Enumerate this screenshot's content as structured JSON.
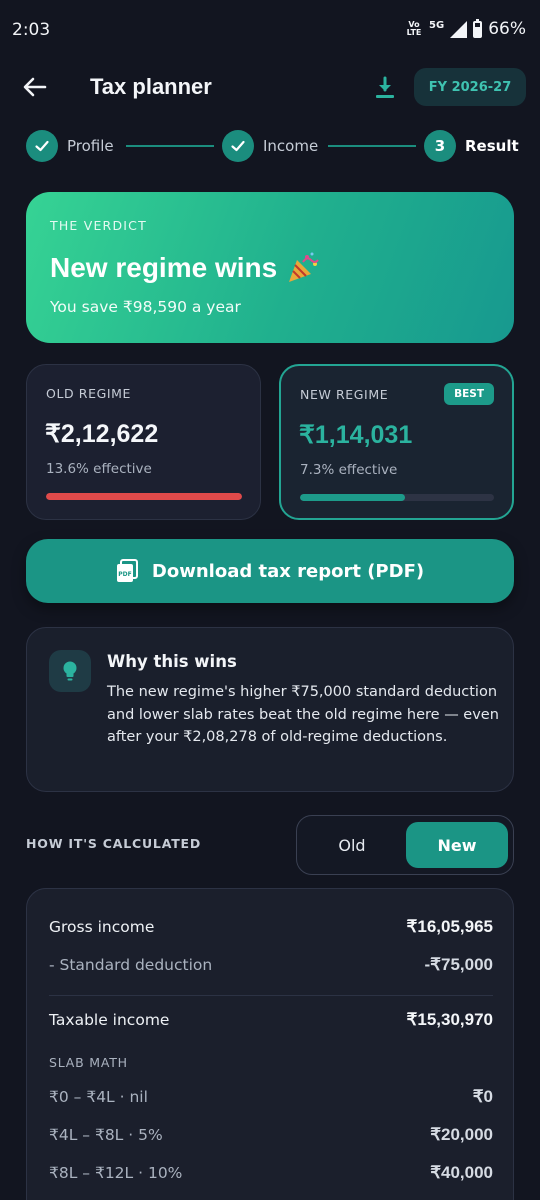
{
  "status_bar": {
    "time": "2:03",
    "volte": "Vo LTE",
    "network": "5G",
    "battery": "66%"
  },
  "app_bar": {
    "title": "Tax planner",
    "fy_chip": "FY 2026-27"
  },
  "stepper": {
    "steps": [
      {
        "label": "Profile",
        "state": "done"
      },
      {
        "label": "Income",
        "state": "done"
      },
      {
        "label": "Result",
        "number": "3",
        "state": "current"
      }
    ]
  },
  "verdict": {
    "kicker": "THE VERDICT",
    "title": "New regime wins",
    "subtitle": "You save ₹98,590 a year"
  },
  "old_regime": {
    "label": "OLD REGIME",
    "amount": "₹2,12,622",
    "effective": "13.6% effective",
    "bar_color": "#e04a4a",
    "bar_fraction": 1.0
  },
  "new_regime": {
    "label": "NEW REGIME",
    "badge": "BEST",
    "amount": "₹1,14,031",
    "effective": "7.3% effective",
    "bar_color": "#1d9b8a",
    "bar_fraction": 0.54
  },
  "download_button": {
    "label": "Download tax report (PDF)"
  },
  "why_card": {
    "title": "Why this wins",
    "body": "The new regime's higher ₹75,000 standard deduction and lower slab rates beat the old regime here — even after your ₹2,08,278 of old-regime deductions."
  },
  "calculation": {
    "heading": "HOW IT'S CALCULATED",
    "toggle": {
      "old": "Old",
      "new": "New",
      "selected": "New"
    },
    "gross_income": {
      "label": "Gross income",
      "value": "₹16,05,965"
    },
    "standard_deduction": {
      "label": "- Standard deduction",
      "value": "-₹75,000"
    },
    "taxable_income": {
      "label": "Taxable income",
      "value": "₹15,30,970"
    },
    "slab_heading": "SLAB MATH",
    "slabs": [
      {
        "label": "₹0 – ₹4L · nil",
        "value": "₹0"
      },
      {
        "label": "₹4L – ₹8L · 5%",
        "value": "₹20,000"
      },
      {
        "label": "₹8L – ₹12L · 10%",
        "value": "₹40,000"
      }
    ]
  },
  "colors": {
    "background": "#121520",
    "accent": "#1b9585",
    "verdict_gradient_start": "#36d394",
    "verdict_gradient_end": "#17998f",
    "old_bar": "#e04a4a"
  }
}
